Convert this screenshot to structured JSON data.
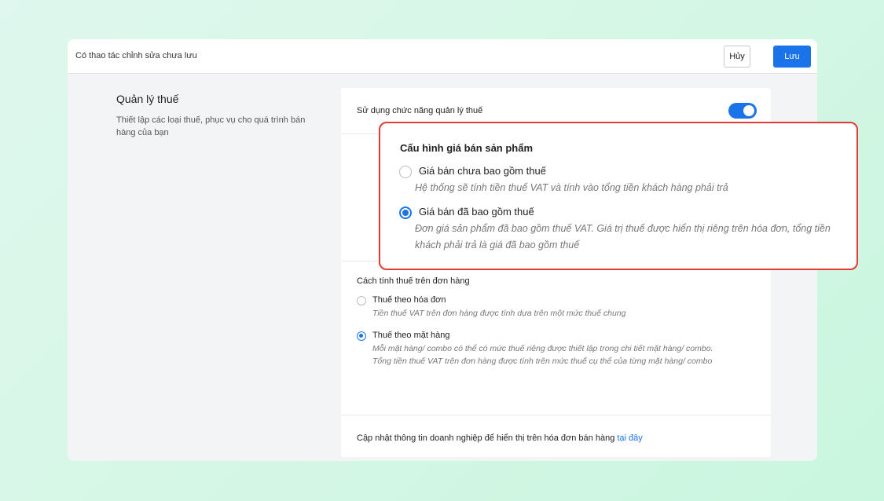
{
  "topbar": {
    "unsaved_text": "Có thao tác chỉnh sửa chưa lưu",
    "cancel_label": "Hủy",
    "save_label": "Lưu"
  },
  "section": {
    "title": "Quản lý thuế",
    "description": "Thiết lập các loại thuế, phục vụ cho quá trình bán hàng của bạn"
  },
  "tax_toggle": {
    "label": "Sử dụng chức năng quản lý thuế",
    "enabled": true
  },
  "price_config": {
    "title": "Cấu hình giá bán sản phẩm",
    "options": [
      {
        "label": "Giá bán chưa bao gồm thuế",
        "description": "Hệ thống sẽ tính tiền thuế VAT và tính vào tổng tiền khách hàng phải trả",
        "selected": false
      },
      {
        "label": "Giá bán đã bao gồm thuế",
        "description": "Đơn giá sản phẩm đã bao gồm thuế VAT. Giá trị thuế được hiển thị riêng trên hóa đơn, tổng tiền khách phải trả là giá đã bao gồm thuế",
        "selected": true
      }
    ]
  },
  "tax_method": {
    "title": "Cách tính thuế trên đơn hàng",
    "options": [
      {
        "label": "Thuế theo hóa đơn",
        "description": "Tiền thuế VAT trên đơn hàng được tính dựa trên một mức thuế chung",
        "selected": false
      },
      {
        "label": "Thuế theo mặt hàng",
        "description_line1": "Mỗi mặt hàng/ combo có thể có mức thuế riêng được thiết lập trong chi tiết mặt hàng/ combo.",
        "description_line2": "Tổng tiền thuế VAT trên đơn hàng được tính trên mức thuế cụ thể của từng mặt hàng/ combo",
        "selected": true
      }
    ]
  },
  "footer": {
    "text": "Cập nhật thông tin doanh nghiệp để hiển thị trên hóa đơn bán hàng ",
    "link_text": "tại đây"
  },
  "colors": {
    "accent": "#1a73e8",
    "callout_border": "#e53935"
  }
}
